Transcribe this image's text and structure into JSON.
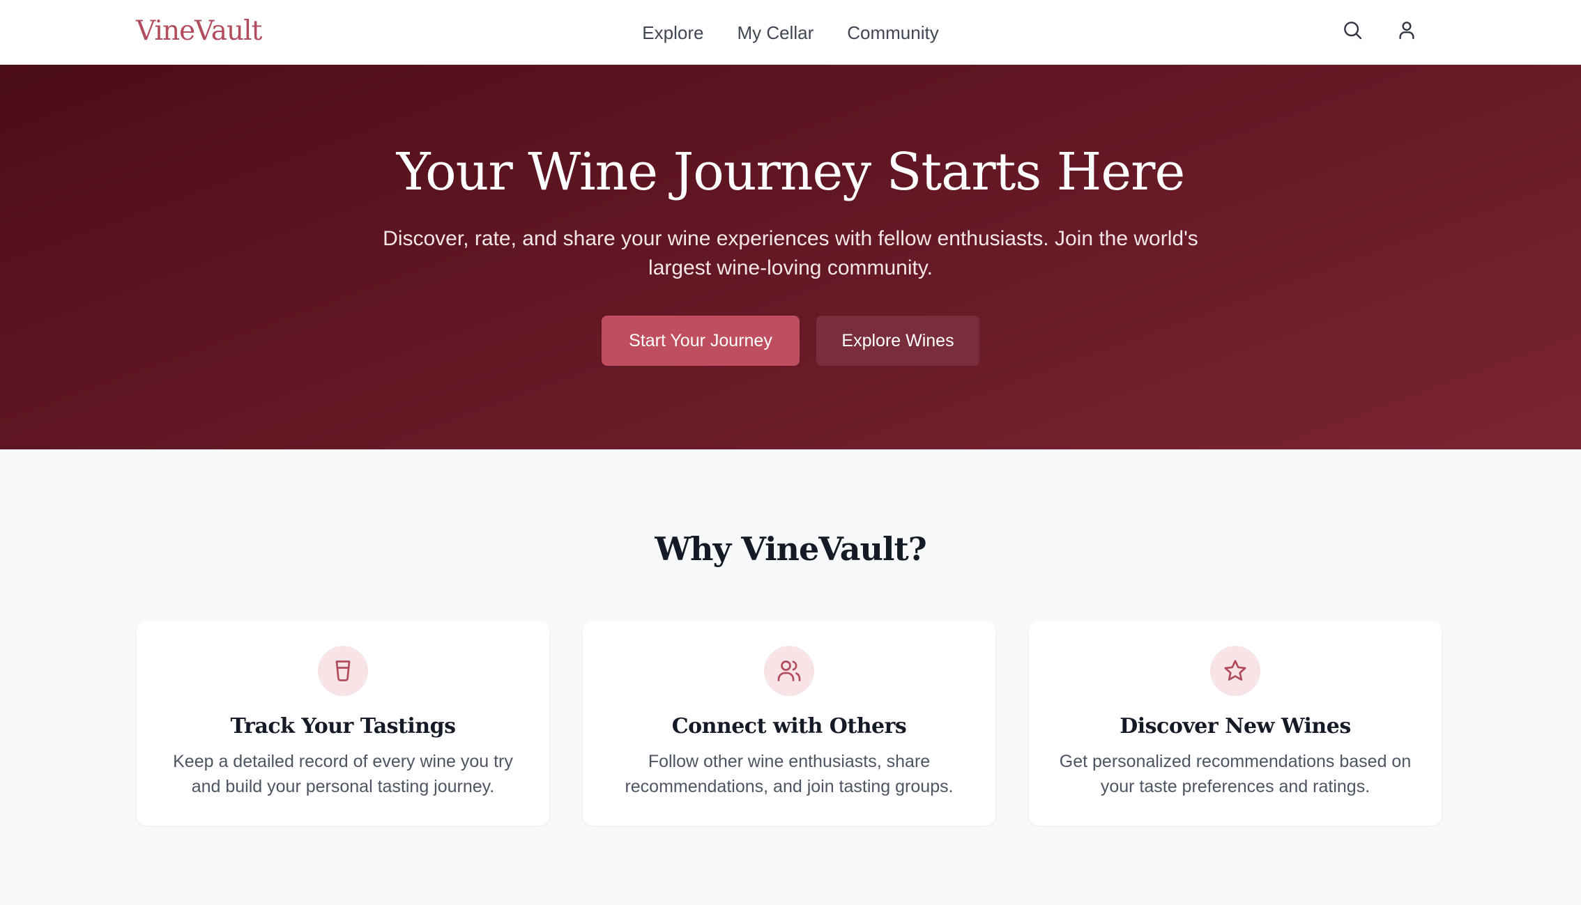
{
  "brand": {
    "name": "VineVault",
    "accent_color": "#b24c5c",
    "hero_color": "#5f1622"
  },
  "nav": {
    "links": [
      "Explore",
      "My Cellar",
      "Community"
    ],
    "actions": {
      "search_icon": "search-icon",
      "user_icon": "user-icon"
    }
  },
  "hero": {
    "title": "Your Wine Journey Starts Here",
    "subtitle": "Discover, rate, and share your wine experiences with fellow enthusiasts. Join the world's largest wine-loving community.",
    "primary_button": "Start Your Journey",
    "secondary_button": "Explore Wines"
  },
  "features": {
    "title": "Why VineVault?",
    "cards": [
      {
        "icon": "wine-glass-icon",
        "title": "Track Your Tastings",
        "description": "Keep a detailed record of every wine you try and build your personal tasting journey."
      },
      {
        "icon": "users-icon",
        "title": "Connect with Others",
        "description": "Follow other wine enthusiasts, share recommendations, and join tasting groups."
      },
      {
        "icon": "star-icon",
        "title": "Discover New Wines",
        "description": "Get personalized recommendations based on your taste preferences and ratings."
      }
    ]
  }
}
